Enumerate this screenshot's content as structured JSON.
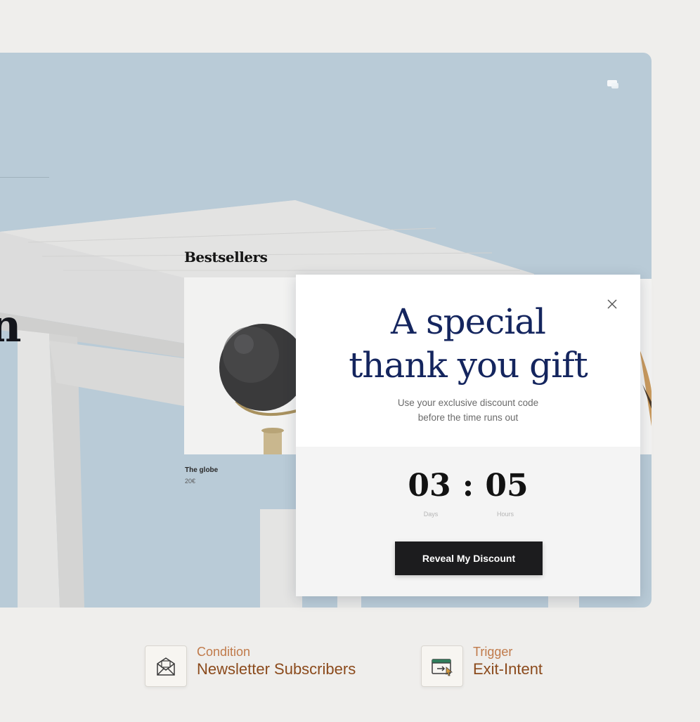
{
  "hero": {
    "edge_letter": "n",
    "corner_icon": "chat-icon"
  },
  "bestsellers": {
    "title": "Bestsellers",
    "product": {
      "name": "The globe",
      "price": "20€"
    }
  },
  "popup": {
    "title_line1": "A special",
    "title_line2": "thank you gift",
    "subtitle_line1": "Use your exclusive discount code",
    "subtitle_line2": "before the time runs out",
    "countdown": {
      "days_value": "03",
      "separator": ":",
      "hours_value": "05",
      "days_label": "Days",
      "hours_label": "Hours"
    },
    "button_label": "Reveal My Discount",
    "close_icon": "close-icon"
  },
  "tags": {
    "condition": {
      "small": "Condition",
      "big": "Newsletter Subscribers",
      "icon": "envelope-icon"
    },
    "trigger": {
      "small": "Trigger",
      "big": "Exit-Intent",
      "icon": "browser-cursor-icon"
    }
  },
  "colors": {
    "background": "#efeeec",
    "hero_blue": "#b9cbd7",
    "popup_title": "#14255e",
    "button": "#1c1c1e",
    "tag_small": "#c07a4a",
    "tag_big": "#8b4a1c"
  }
}
